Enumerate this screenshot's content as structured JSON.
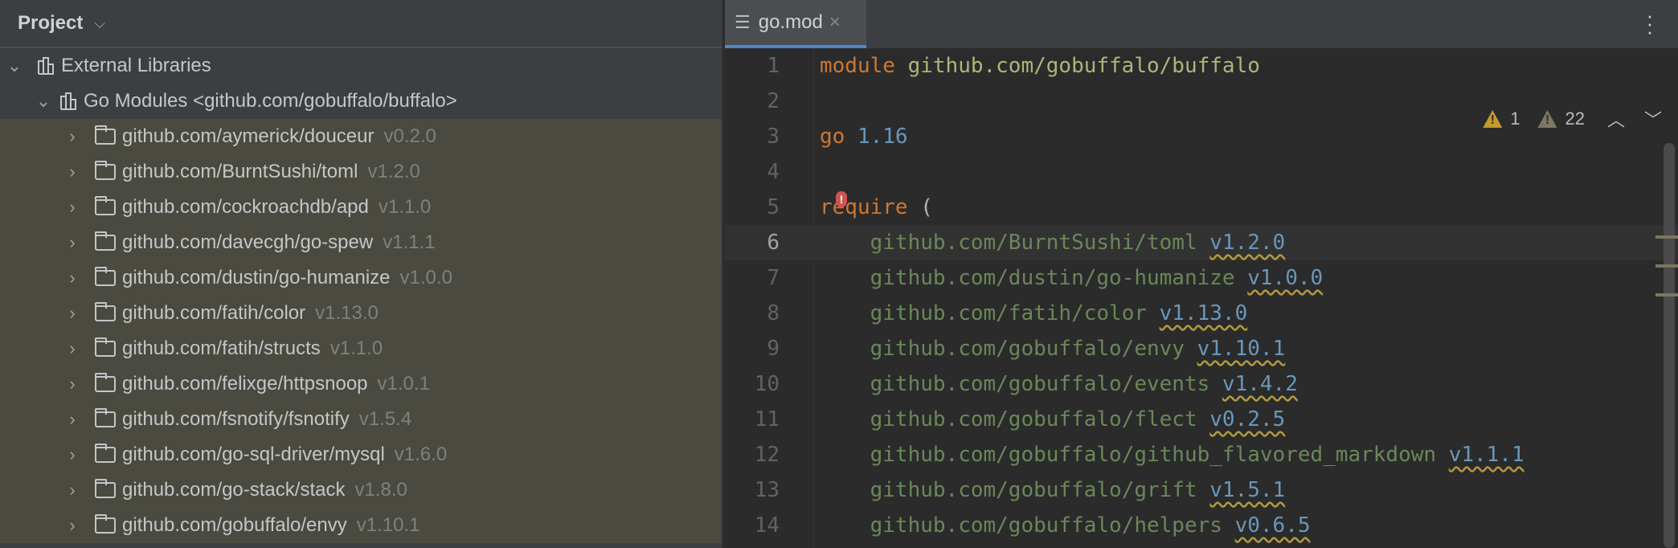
{
  "project": {
    "title": "Project",
    "root": "External Libraries",
    "modules": "Go Modules <github.com/gobuffalo/buffalo>",
    "libraries": [
      {
        "name": "github.com/aymerick/douceur",
        "version": "v0.2.0"
      },
      {
        "name": "github.com/BurntSushi/toml",
        "version": "v1.2.0"
      },
      {
        "name": "github.com/cockroachdb/apd",
        "version": "v1.1.0"
      },
      {
        "name": "github.com/davecgh/go-spew",
        "version": "v1.1.1"
      },
      {
        "name": "github.com/dustin/go-humanize",
        "version": "v1.0.0"
      },
      {
        "name": "github.com/fatih/color",
        "version": "v1.13.0"
      },
      {
        "name": "github.com/fatih/structs",
        "version": "v1.1.0"
      },
      {
        "name": "github.com/felixge/httpsnoop",
        "version": "v1.0.1"
      },
      {
        "name": "github.com/fsnotify/fsnotify",
        "version": "v1.5.4"
      },
      {
        "name": "github.com/go-sql-driver/mysql",
        "version": "v1.6.0"
      },
      {
        "name": "github.com/go-stack/stack",
        "version": "v1.8.0"
      },
      {
        "name": "github.com/gobuffalo/envy",
        "version": "v1.10.1"
      }
    ]
  },
  "editor": {
    "tab": "go.mod",
    "close": "×",
    "warnings": "1",
    "weak_warnings": "22",
    "line1": {
      "kw": "module",
      "path": "github.com/gobuffalo/buffalo"
    },
    "line3": {
      "kw": "go",
      "ver": "1.16"
    },
    "line5": {
      "kw": "require",
      "paren": "("
    },
    "requires": [
      {
        "path": "github.com/BurntSushi/toml",
        "version": "v1.2.0"
      },
      {
        "path": "github.com/dustin/go-humanize",
        "version": "v1.0.0"
      },
      {
        "path": "github.com/fatih/color",
        "version": "v1.13.0"
      },
      {
        "path": "github.com/gobuffalo/envy",
        "version": "v1.10.1"
      },
      {
        "path": "github.com/gobuffalo/events",
        "version": "v1.4.2"
      },
      {
        "path": "github.com/gobuffalo/flect",
        "version": "v0.2.5"
      },
      {
        "path": "github.com/gobuffalo/github_flavored_markdown",
        "version": "v1.1.1"
      },
      {
        "path": "github.com/gobuffalo/grift",
        "version": "v1.5.1"
      },
      {
        "path": "github.com/gobuffalo/helpers",
        "version": "v0.6.5"
      }
    ]
  }
}
